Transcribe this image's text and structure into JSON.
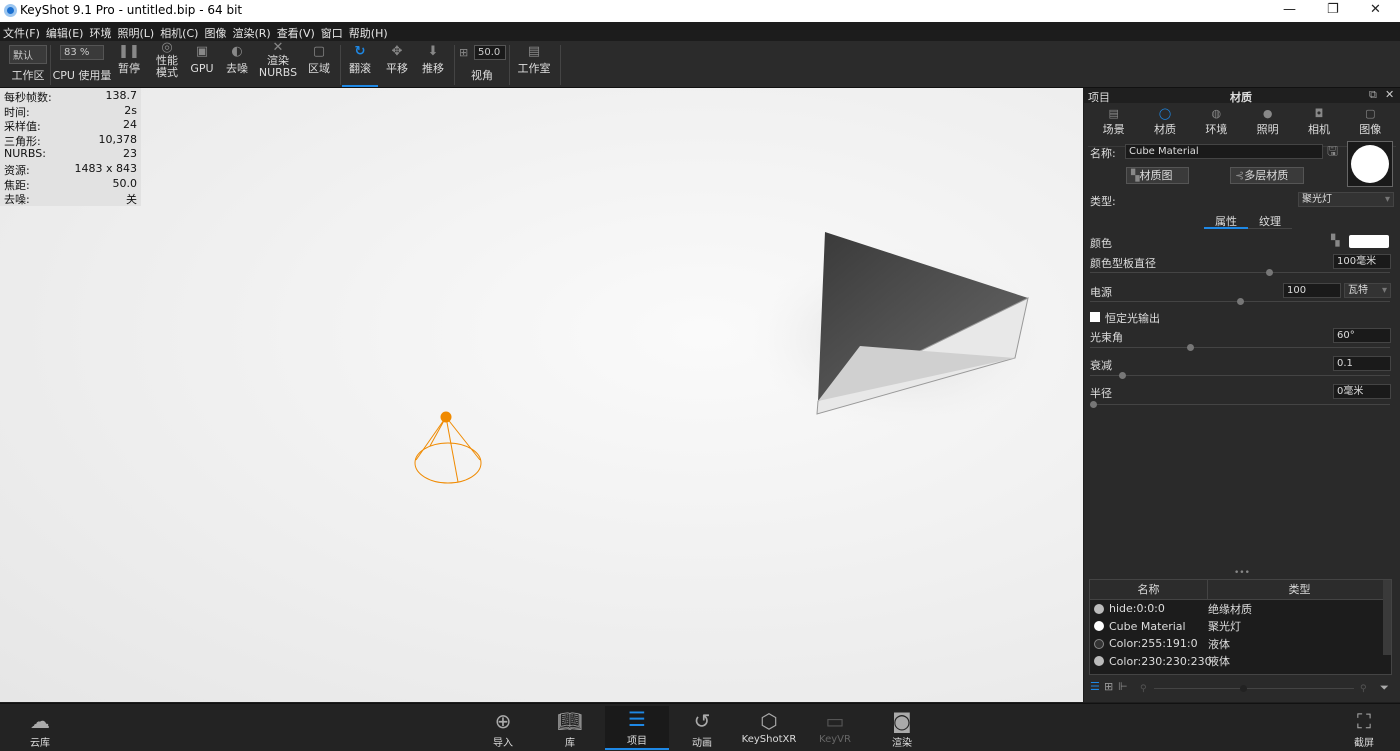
{
  "window": {
    "title": "KeyShot 9.1 Pro  - untitled.bip  - 64 bit"
  },
  "menu": [
    "文件(F)",
    "编辑(E)",
    "环境",
    "照明(L)",
    "相机(C)",
    "图像",
    "渲染(R)",
    "查看(V)",
    "窗口",
    "帮助(H)"
  ],
  "toolbar": {
    "workspace_value": "默认",
    "workspace_label": "工作区",
    "cpu_value": "83 %",
    "cpu_label": "CPU 使用量",
    "pause": "暂停",
    "perf_mode": "性能\n模式",
    "gpu": "GPU",
    "denoise": "去噪",
    "nurbs": "渲染\nNURBS",
    "region": "区域",
    "tumble": "翻滚",
    "pan": "平移",
    "dolly": "推移",
    "fov_value": "50.0",
    "fov_label": "视角",
    "studio": "工作室"
  },
  "stats": [
    [
      "每秒帧数:",
      "138.7"
    ],
    [
      "时间:",
      "2s"
    ],
    [
      "采样值:",
      "24"
    ],
    [
      "三角形:",
      "10,378"
    ],
    [
      "NURBS:",
      "23"
    ],
    [
      "资源:",
      "1483 x 843"
    ],
    [
      "焦距:",
      "50.0"
    ],
    [
      "去噪:",
      "关"
    ]
  ],
  "panel": {
    "left_title": "项目",
    "title": "材质",
    "tabs": [
      {
        "label": "场景",
        "icon": "scene-icon"
      },
      {
        "label": "材质",
        "icon": "material-icon",
        "active": true
      },
      {
        "label": "环境",
        "icon": "environment-icon"
      },
      {
        "label": "照明",
        "icon": "lighting-icon"
      },
      {
        "label": "相机",
        "icon": "camera-icon"
      },
      {
        "label": "图像",
        "icon": "image-icon"
      }
    ],
    "name_label": "名称:",
    "name_value": "Cube Material",
    "graph_btn": "材质图",
    "multi_btn": "多层材质",
    "type_label": "类型:",
    "type_value": "聚光灯",
    "subtabs": [
      "属性",
      "纹理"
    ],
    "color_label": "颜色",
    "color_value": "#ffffff",
    "swatch_label": "颜色型板直径",
    "swatch_value": "100毫米",
    "swatch_slider": 0.6,
    "power_label": "电源",
    "power_value": "100",
    "power_unit": "瓦特",
    "power_slider": 0.5,
    "constant_label": "恒定光输出",
    "constant_checked": false,
    "beam_label": "光束角",
    "beam_value": "60°",
    "beam_slider": 0.33,
    "falloff_label": "衰减",
    "falloff_value": "0.1",
    "falloff_slider": 0.1,
    "radius_label": "半径",
    "radius_value": "0毫米",
    "radius_slider": 0.0,
    "table": {
      "headers": [
        "名称",
        "类型"
      ],
      "rows": [
        {
          "name": "hide:0:0:0",
          "type": "绝缘材质",
          "color": "#bbbbbb"
        },
        {
          "name": "Cube Material",
          "type": "聚光灯",
          "color": "#ffffff"
        },
        {
          "name": "Color:255:191:0",
          "type": "液体",
          "color": "#333333"
        },
        {
          "name": "Color:230:230:230",
          "type": "液体",
          "color": "#bbbbbb"
        }
      ]
    }
  },
  "bottom": {
    "cloud": "云库",
    "import": "导入",
    "library": "库",
    "project": "项目",
    "animation": "动画",
    "keyshotxr": "KeyShotXR",
    "keyvr": "KeyVR",
    "render": "渲染",
    "screenshot": "截屏"
  },
  "colors": {
    "accent": "#1e88e5",
    "light_cone": "#f08a00"
  }
}
